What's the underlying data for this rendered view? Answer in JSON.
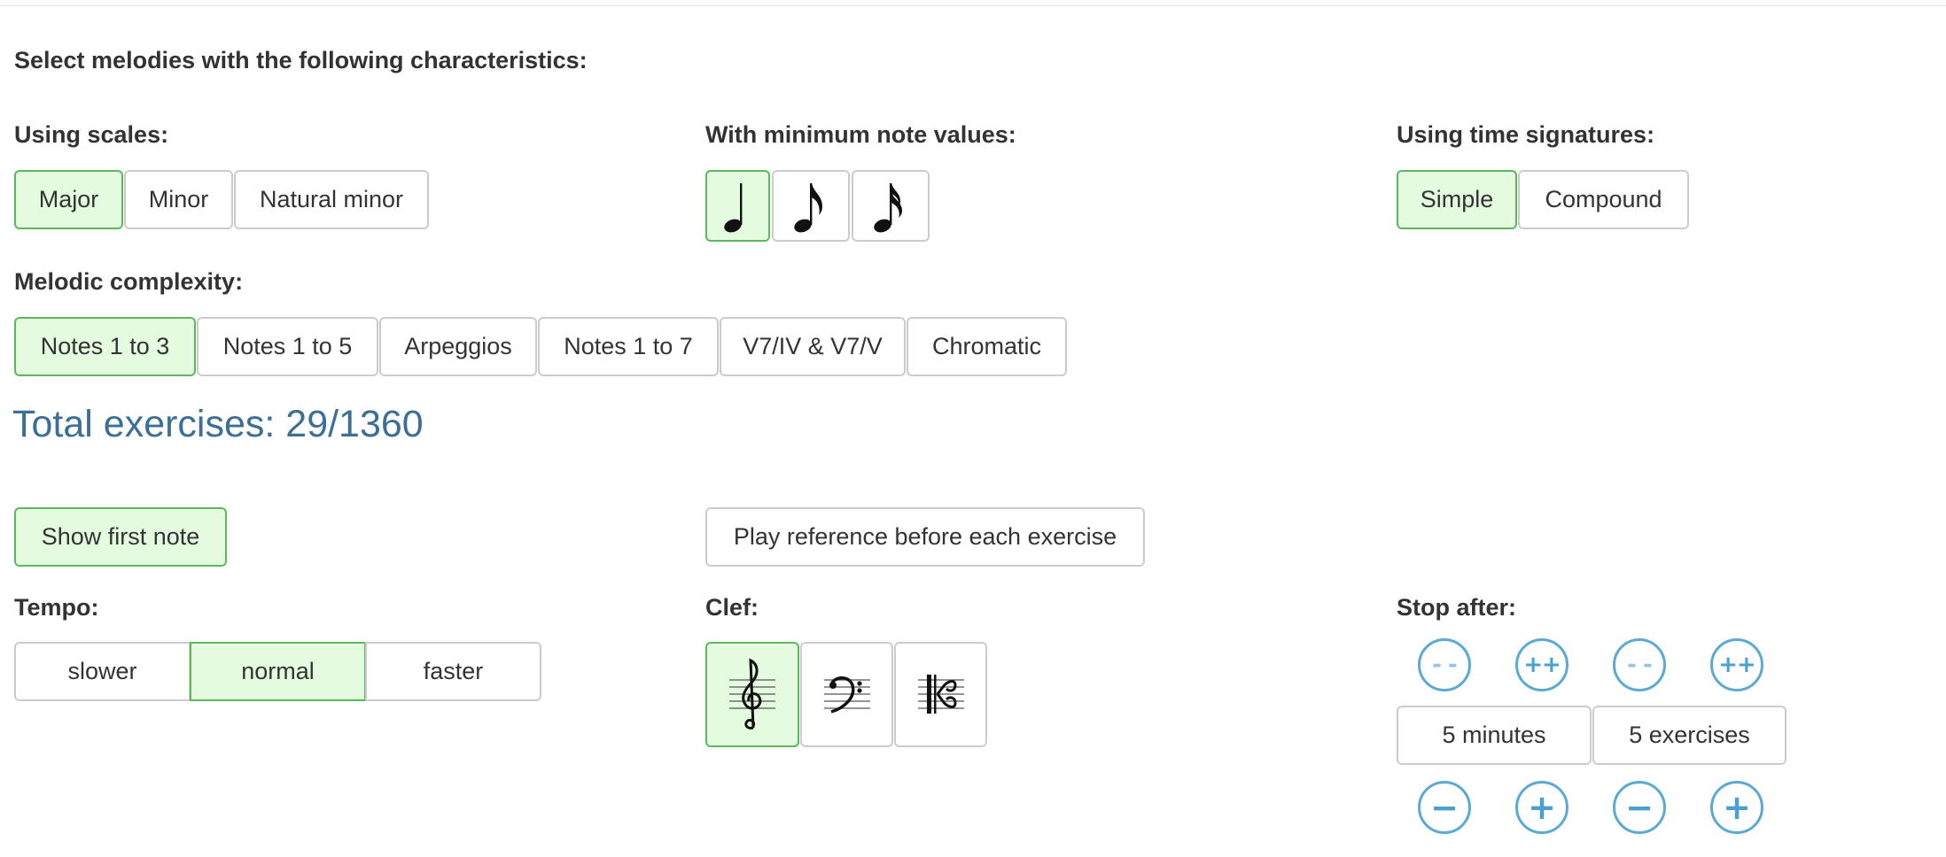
{
  "section_title": "Select melodies with the following characteristics:",
  "scales": {
    "label": "Using scales:",
    "options": [
      "Major",
      "Minor",
      "Natural minor"
    ],
    "selected": "Major"
  },
  "note_values": {
    "label": "With minimum note values:",
    "options": [
      "quarter-note-icon",
      "eighth-note-icon",
      "sixteenth-note-icon"
    ],
    "selected": "quarter-note-icon"
  },
  "time_signatures": {
    "label": "Using time signatures:",
    "options": [
      "Simple",
      "Compound"
    ],
    "selected": "Simple"
  },
  "complexity": {
    "label": "Melodic complexity:",
    "options": [
      "Notes 1 to 3",
      "Notes 1 to 5",
      "Arpeggios",
      "Notes 1 to 7",
      "V7/IV & V7/V",
      "Chromatic"
    ],
    "selected": "Notes 1 to 3"
  },
  "total_exercises": "Total exercises: 29/1360",
  "toggles": {
    "show_first_note": "Show first note",
    "show_first_note_on": true,
    "play_reference": "Play reference before each exercise",
    "play_reference_on": false
  },
  "tempo": {
    "label": "Tempo:",
    "options": [
      "slower",
      "normal",
      "faster"
    ],
    "selected": "normal"
  },
  "clef": {
    "label": "Clef:",
    "options": [
      "treble-clef-icon",
      "bass-clef-icon",
      "alto-clef-icon"
    ],
    "selected": "treble-clef-icon"
  },
  "stop_after": {
    "label": "Stop after:",
    "minutes": "5 minutes",
    "exercises": "5 exercises",
    "double_decrease": "- -",
    "double_increase": "++",
    "decrease": "−",
    "increase": "+"
  },
  "colors": {
    "selected_bg": "#e5fbe0",
    "selected_border": "#5cb85c",
    "total_text": "#3b6f96",
    "stepper_blue": "#4aa0d0"
  }
}
